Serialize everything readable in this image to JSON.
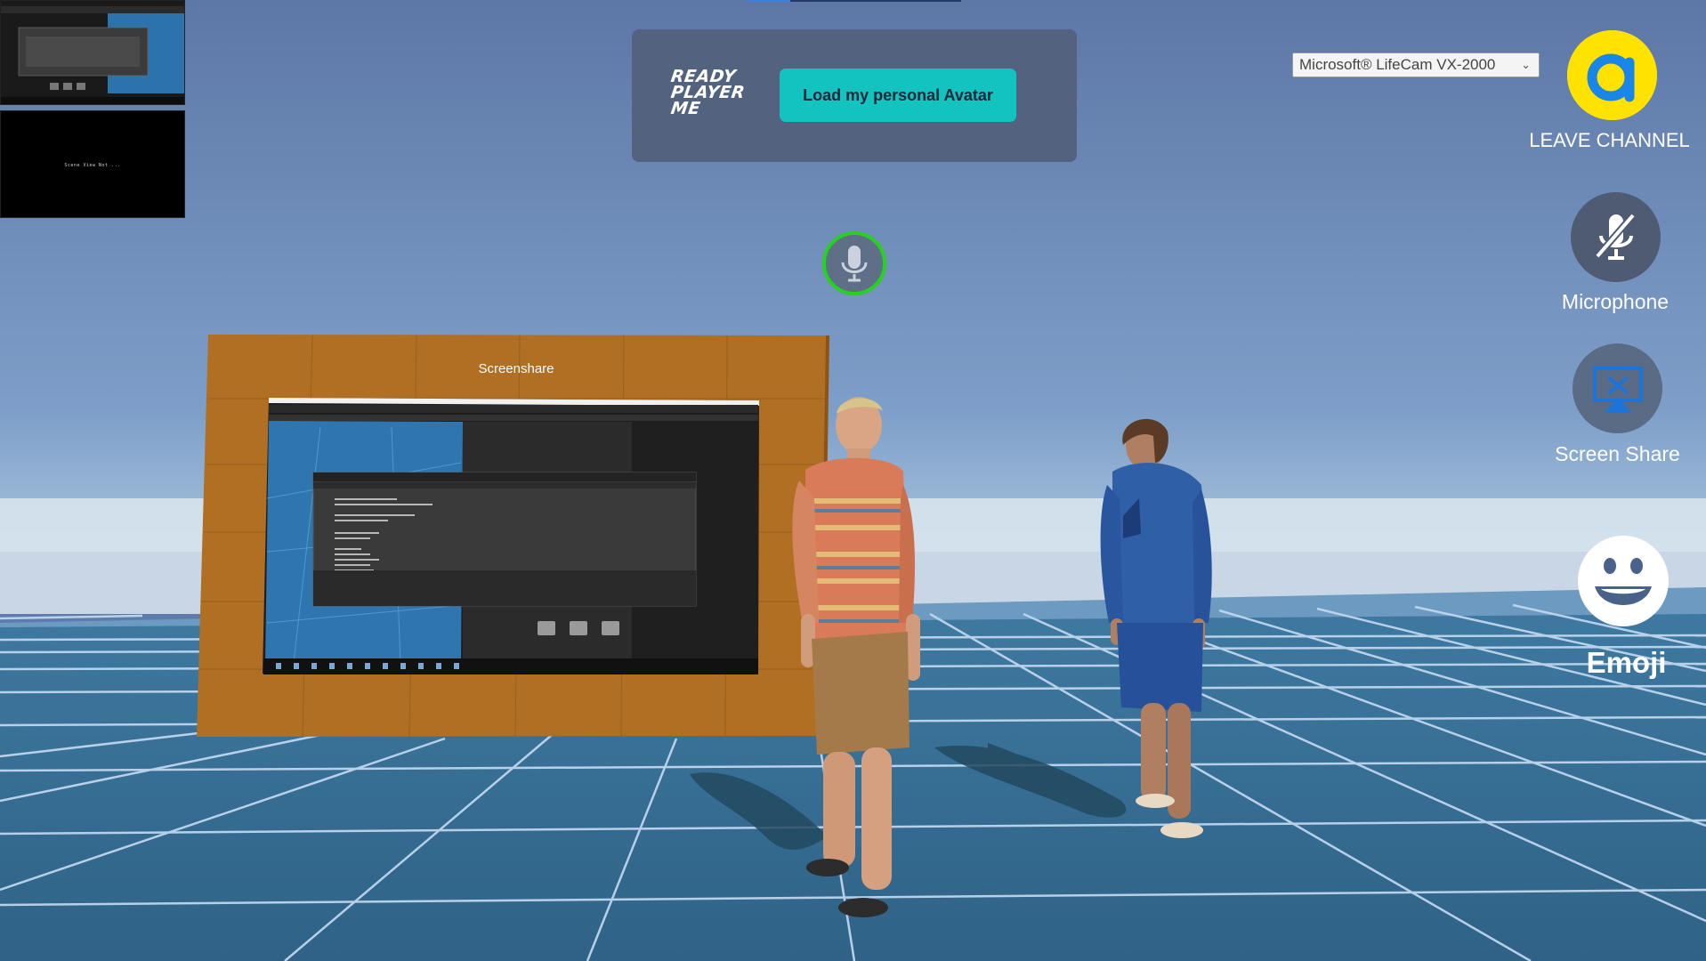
{
  "thumbnails": [
    {
      "kind": "screen-capture"
    },
    {
      "kind": "blank-feed",
      "text": "Scene View Not ..."
    }
  ],
  "ready_player_me": {
    "logo_lines": [
      "READY",
      "PLAYER",
      "ME"
    ],
    "load_button_label": "Load my personal Avatar"
  },
  "webcam": {
    "selected": "Microsoft® LifeCam VX-2000"
  },
  "controls": {
    "leave_label": "LEAVE CHANNEL",
    "microphone_label": "Microphone",
    "screen_share_label": "Screen Share",
    "emoji_label": "Emoji"
  },
  "scene": {
    "screenshare_label": "Screenshare"
  },
  "colors": {
    "sky": "#6c8bbd",
    "floor": "#3a6f96",
    "grid_line": "#c8dcf0",
    "rpm_button": "#13c3c0",
    "agora_yellow": "#ffe200",
    "speaking_ring": "#27d11f",
    "board_wood": "#b06f23"
  },
  "icons": {
    "agora": "agora-logo-icon",
    "microphone": "mic-muted-icon",
    "screen_share": "screen-share-icon",
    "emoji": "smile-icon",
    "speaker": "mic-icon"
  }
}
